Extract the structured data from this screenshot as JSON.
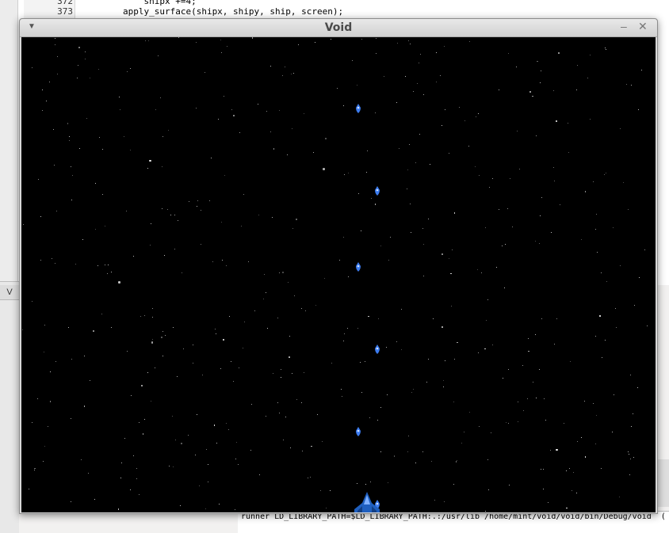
{
  "ide": {
    "code_lines": [
      {
        "num": "372",
        "code": "            shipx +=4;"
      },
      {
        "num": "373",
        "code": "        apply_surface(shipx, shipy, ship, screen);"
      }
    ],
    "side_tab": "V",
    "console_text": "runner LD_LIBRARY_PATH=$LD_LIBRARY_PATH:.:/usr/lib /home/mint/void/void/bin/Debug/void  ("
  },
  "window": {
    "title": "Void",
    "menu_icon": "chevron-down-icon",
    "minimize_icon": "minimize-icon",
    "close_icon": "close-icon"
  },
  "colors": {
    "space": "#000000",
    "bullet": "#3c7cf0",
    "ship": "#1f5fbf"
  }
}
